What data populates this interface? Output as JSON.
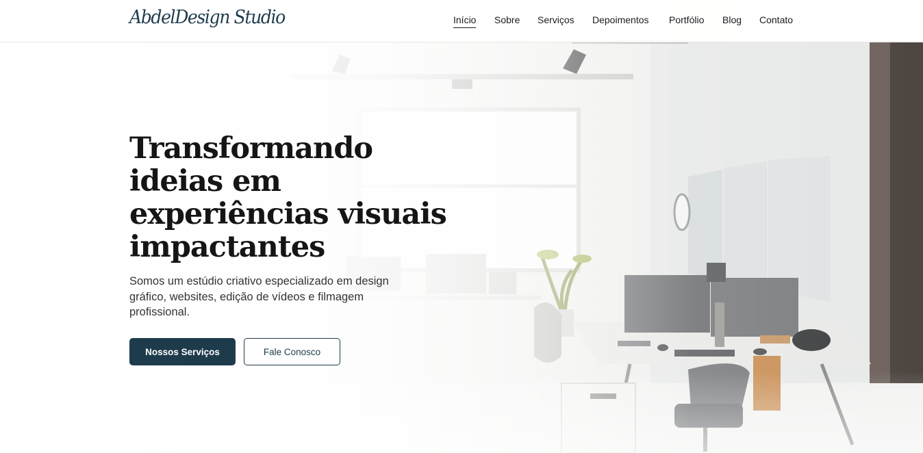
{
  "brand": {
    "logo_text": "AbdelDesign Studio",
    "primary_color": "#1e3b4c"
  },
  "nav": {
    "items": [
      {
        "label": "Início",
        "active": true
      },
      {
        "label": "Sobre",
        "active": false
      },
      {
        "label": "Serviços",
        "active": false
      },
      {
        "label": "Depoimentos",
        "active": false
      },
      {
        "label": "Portfólio",
        "active": false
      },
      {
        "label": "Blog",
        "active": false
      },
      {
        "label": "Contato",
        "active": false
      }
    ]
  },
  "hero": {
    "title_lines": [
      "Transformando",
      "ideias em",
      "experiências visuais",
      "impactantes"
    ],
    "subtitle": "Somos um estúdio criativo especializado em design gráfico, websites, edição de vídeos e filmagem profissional.",
    "primary_button": "Nossos Serviços",
    "secondary_button": "Fale Conosco",
    "background_image": "office-workspace-illustration"
  }
}
